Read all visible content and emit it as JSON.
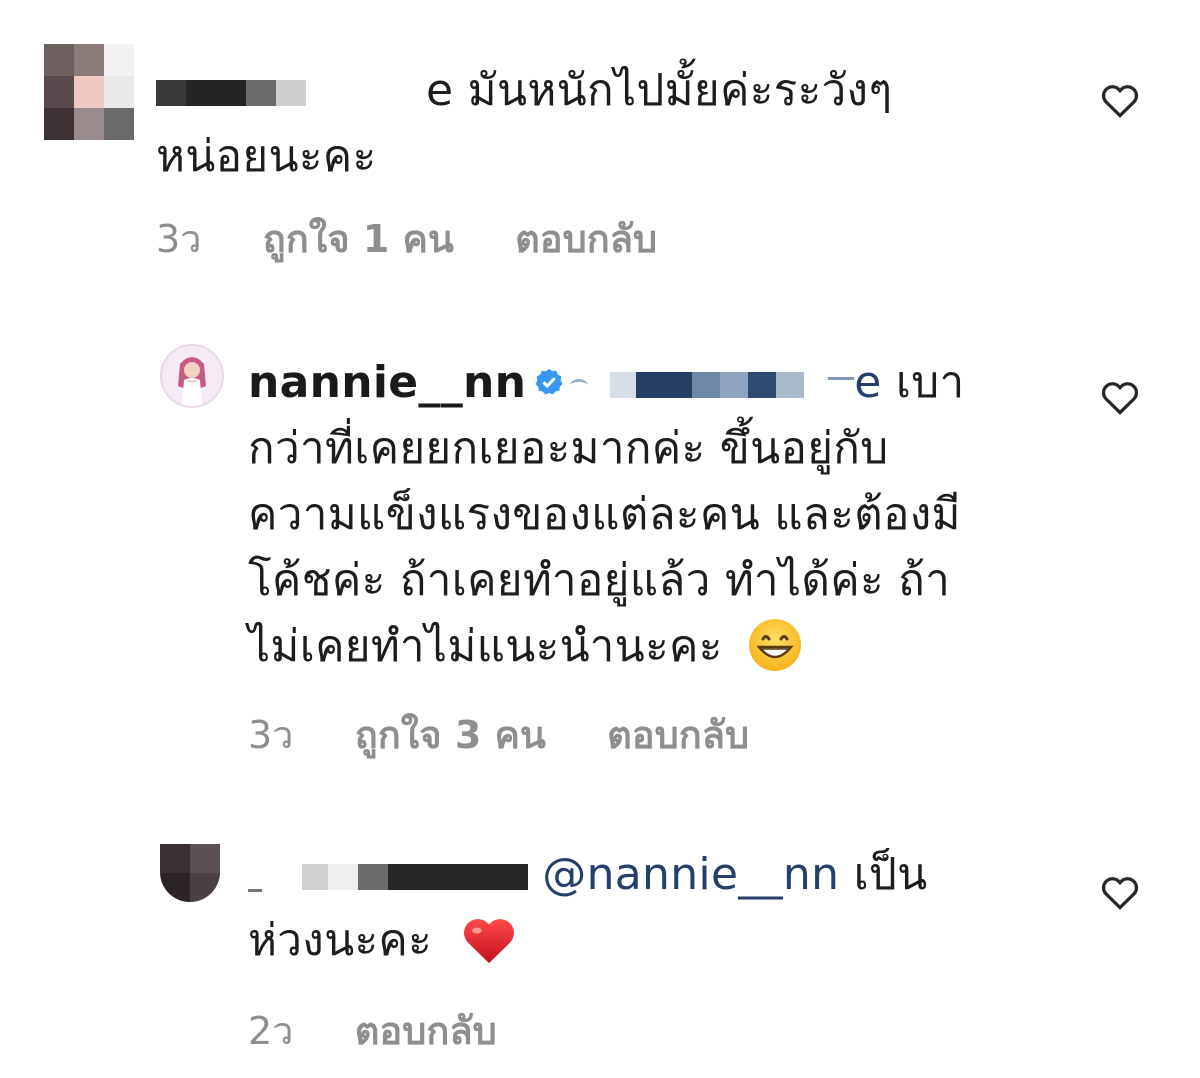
{
  "comments": [
    {
      "text_line1_tail": "e มันหนักไปมั้ยค่ะระวังๆ",
      "text_line2": "หน่อยนะคะ",
      "time": "3ว",
      "likes": "ถูกใจ 1 คน",
      "reply": "ตอบกลับ"
    },
    {
      "username": "nannie__nn",
      "mention_tail": "e",
      "text_line1_tail": "เบา",
      "text_line2": "กว่าที่เคยยกเยอะมากค่ะ ขึ้นอยู่กับ",
      "text_line3": "ความแข็งแรงของแต่ละคน และต้องมี",
      "text_line4": "โค้ชค่ะ ถ้าเคยทำอยู่แล้ว ทำได้ค่ะ ถ้า",
      "text_line5": "ไม่เคยทำไม่แนะนำนะคะ",
      "emoji": "grinning-face",
      "time": "3ว",
      "likes": "ถูกใจ 3 คน",
      "reply": "ตอบกลับ"
    },
    {
      "mention": "@nannie__nn",
      "text_line1_tail": "เป็น",
      "text_line2": "ห่วงนะคะ",
      "emoji": "red-heart",
      "time": "2ว",
      "reply": "ตอบกลับ"
    }
  ],
  "icons": {
    "like": "heart-outline-icon",
    "verified": "verified-badge-icon"
  },
  "colors": {
    "meta": "#8e8e8e",
    "mention": "#24406a",
    "verified": "#3897f0"
  }
}
